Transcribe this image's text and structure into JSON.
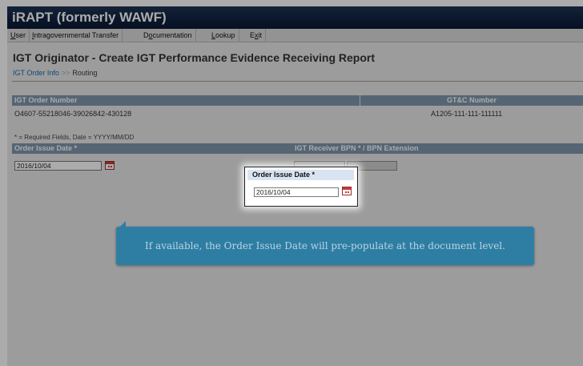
{
  "app": {
    "title": "iRAPT (formerly WAWF)"
  },
  "menu": [
    {
      "pre": "",
      "key": "U",
      "post": "ser"
    },
    {
      "pre": "",
      "key": "I",
      "post": "ntragovernmental Transfer"
    },
    {
      "pre": "D",
      "key": "o",
      "post": "cumentation"
    },
    {
      "pre": "",
      "key": "L",
      "post": "ookup"
    },
    {
      "pre": "E",
      "key": "x",
      "post": "it"
    }
  ],
  "page": {
    "title": "IGT Originator - Create IGT Performance Evidence Receiving Report",
    "breadcrumb": {
      "link": "IGT Order Info",
      "separator": ">>",
      "current": "Routing"
    }
  },
  "order": {
    "igt_order_number_label": "IGT Order Number",
    "igt_order_number": "O4607-55218046-39026842-430128",
    "gtc_label": "GT&C Number",
    "gtc_number": "A1205-111-111-111111"
  },
  "form": {
    "required_note": "* = Required Fields, Date = YYYY/MM/DD",
    "issue_date_label": "Order Issue Date *",
    "issue_date_value": "2016/10/04",
    "bpn_label": "IGT Receiver BPN * / BPN Extension"
  },
  "popup": {
    "label": "Order Issue Date *",
    "value": "2016/10/04"
  },
  "tooltip": {
    "text": "If available, the Order Issue Date will pre-populate at the document level."
  },
  "colors": {
    "header_bar": "#7f97ae",
    "title_bar": "#0f2140",
    "tooltip": "#2e7ea3",
    "link": "#1b69b5"
  },
  "icons": {
    "calendar": "calendar-icon"
  }
}
